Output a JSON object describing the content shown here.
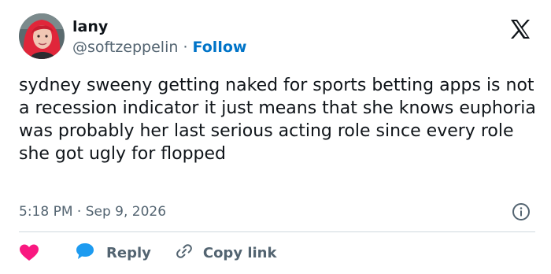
{
  "user": {
    "name": "lany",
    "handle": "@softzeppelin",
    "separator": "·",
    "follow_label": "Follow"
  },
  "tweet": {
    "text": "sydney sweeny getting naked for sports betting apps is not a recession indicator it just means that she knows euphoria was probably her last serious acting role since every role she got ugly for flopped",
    "time": "5:18 PM",
    "separator": "·",
    "date": "Sep 9, 2026"
  },
  "actions": {
    "like_icon": "heart-icon",
    "reply_label": "Reply",
    "copy_link_label": "Copy link"
  },
  "icons": {
    "logo": "x-logo-icon",
    "info": "info-icon",
    "reply": "speech-bubble-icon",
    "copy_link": "chain-link-icon"
  },
  "colors": {
    "text": "#0f1419",
    "secondary": "#536471",
    "follow": "#0074c8",
    "heart": "#f91880",
    "reply_bubble": "#1d9bf0",
    "divider": "#cfd9de"
  }
}
